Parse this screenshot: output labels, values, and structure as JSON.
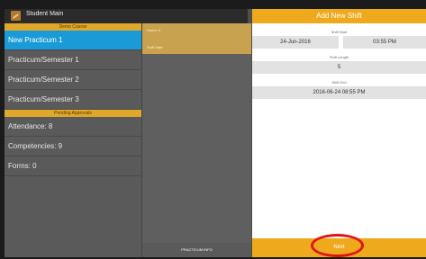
{
  "app": {
    "title": "Student Main"
  },
  "sidebar": {
    "section1": "Demo Course",
    "items": [
      {
        "label": "New Practicum 1",
        "selected": true
      },
      {
        "label": "Practicum/Semester 1"
      },
      {
        "label": "Practicum/Semester 2"
      },
      {
        "label": "Practicum/Semester 3"
      }
    ],
    "section2": "Pending Approvals",
    "approvals": [
      {
        "label": "Attendance: 8"
      },
      {
        "label": "Competencies: 9"
      },
      {
        "label": "Forms: 0"
      }
    ]
  },
  "middle": {
    "hours": "Hours: 0",
    "shift_start": "Shift Start",
    "footer": "PRACTICUM INFO"
  },
  "dialog": {
    "title": "Add New Shift",
    "shift_start_label": "Shift Start",
    "start_date": "24-Jun-2016",
    "start_time": "03:55 PM",
    "shift_length_label": "Shift Length",
    "shift_length": "5",
    "shift_end_label": "Shift End",
    "shift_end": "2016-06-24 08:55 PM",
    "next_label": "Next"
  },
  "colors": {
    "accent": "#efa91c",
    "selected": "#1a9bd8",
    "highlight": "#e01515"
  }
}
